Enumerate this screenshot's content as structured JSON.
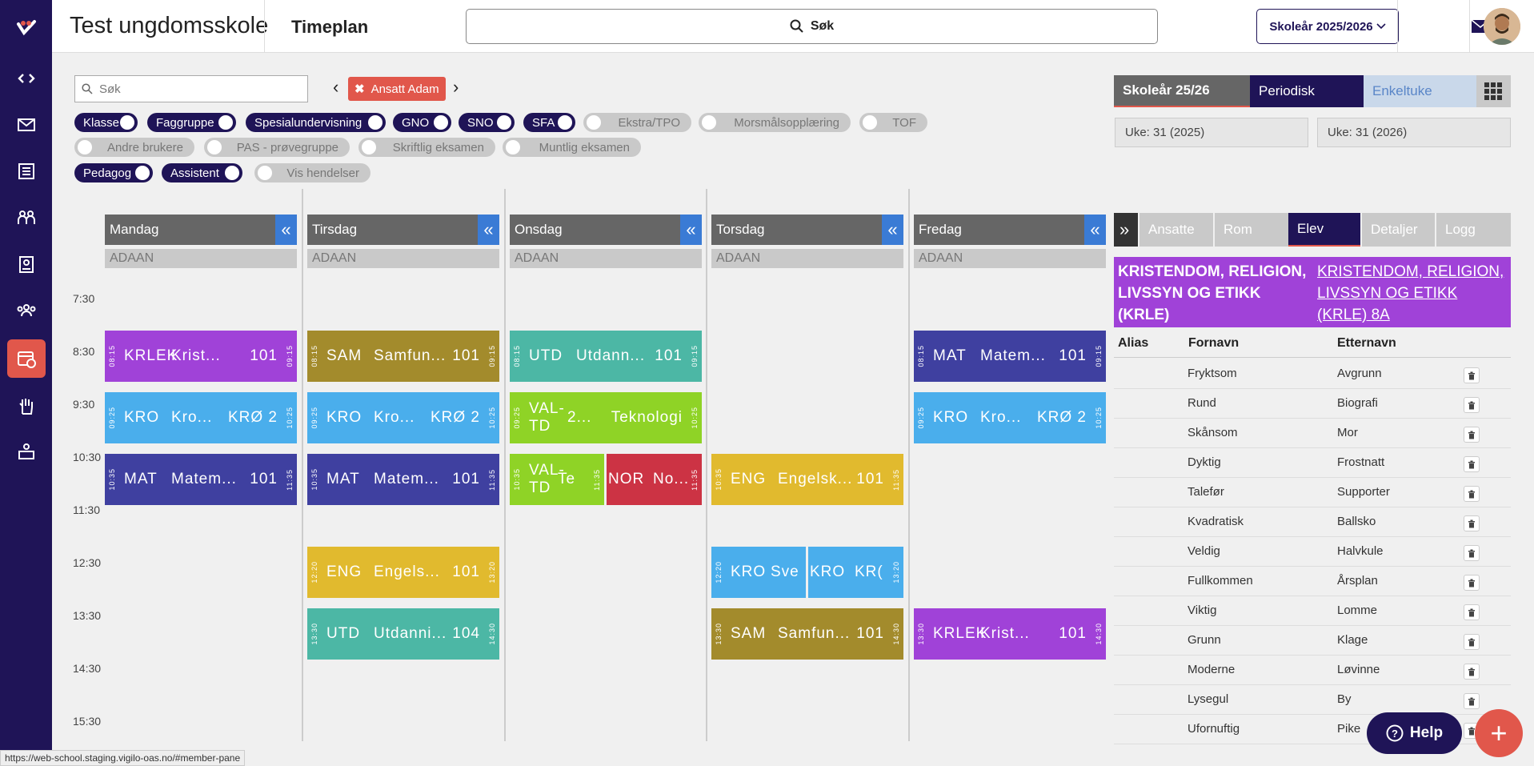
{
  "colors": {
    "brand": "#1f1457",
    "accent": "#e1574b",
    "krle": "#a042d8",
    "kro": "#4aaeec",
    "mat": "#3f40a0",
    "sam": "#a38b2c",
    "utd": "#4cb7a5",
    "val": "#8fd326",
    "eng": "#e1ba2e",
    "nor": "#cc3344"
  },
  "sidebar": {
    "icons": [
      "code-icon",
      "mail-icon",
      "newspaper-icon",
      "people-icon",
      "id-badge-icon",
      "group-icon",
      "schedule-icon",
      "hand-icon",
      "user-desk-icon"
    ],
    "active_index": 6
  },
  "header": {
    "school": "Test ungdomsskole",
    "title": "Timeplan",
    "search_label": "Søk",
    "year_select": "Skoleår 2025/2026"
  },
  "filters": {
    "search_placeholder": "Søk",
    "selected_chip": "Ansatt Adam",
    "toggles": [
      {
        "label": "Klasse",
        "on": true
      },
      {
        "label": "Faggruppe",
        "on": true
      },
      {
        "label": "Spesialundervisning",
        "on": true
      },
      {
        "label": "GNO",
        "on": true
      },
      {
        "label": "SNO",
        "on": true
      },
      {
        "label": "SFA",
        "on": true
      },
      {
        "label": "Ekstra/TPO",
        "on": false
      },
      {
        "label": "Morsmålsopplæring",
        "on": false
      },
      {
        "label": "TOF",
        "on": false
      },
      {
        "label": "Andre brukere",
        "on": false
      },
      {
        "label": "PAS - prøvegruppe",
        "on": false
      },
      {
        "label": "Skriftlig eksamen",
        "on": false
      },
      {
        "label": "Muntlig eksamen",
        "on": false
      },
      {
        "label": "Pedagog",
        "on": true
      },
      {
        "label": "Assistent",
        "on": true
      },
      {
        "label": "Vis hendelser",
        "on": false
      }
    ]
  },
  "period_tabs": [
    {
      "label": "Skoleår 25/26",
      "selected": true
    },
    {
      "label": "Periodisk",
      "selected": false
    },
    {
      "label": "Enkeltuke",
      "selected": false
    }
  ],
  "weeks": {
    "from": "Uke: 31 (2025)",
    "to": "Uke: 31 (2026)"
  },
  "days": [
    {
      "name": "Mandag",
      "res": "ADAAN"
    },
    {
      "name": "Tirsdag",
      "res": "ADAAN"
    },
    {
      "name": "Onsdag",
      "res": "ADAAN"
    },
    {
      "name": "Torsdag",
      "res": "ADAAN"
    },
    {
      "name": "Fredag",
      "res": "ADAAN"
    }
  ],
  "collapse_glyph": "«",
  "times": [
    "7:30",
    "8:30",
    "9:30",
    "10:30",
    "11:30",
    "12:30",
    "13:30",
    "14:30",
    "15:30"
  ],
  "lessons": [
    {
      "day": 0,
      "start": "08:15",
      "end": "09:15",
      "code": "KRLEK",
      "name": "Krist...",
      "room": "101",
      "color": "krle"
    },
    {
      "day": 0,
      "start": "09:25",
      "end": "10:25",
      "code": "KRO",
      "name": "Kro...",
      "room": "KRØ 2",
      "color": "kro"
    },
    {
      "day": 0,
      "start": "10:35",
      "end": "11:35",
      "code": "MAT",
      "name": "Matem...",
      "room": "101",
      "color": "mat"
    },
    {
      "day": 1,
      "start": "08:15",
      "end": "09:15",
      "code": "SAM",
      "name": "Samfun...",
      "room": "101",
      "color": "sam"
    },
    {
      "day": 1,
      "start": "09:25",
      "end": "10:25",
      "code": "KRO",
      "name": "Kro...",
      "room": "KRØ 2",
      "color": "kro"
    },
    {
      "day": 1,
      "start": "10:35",
      "end": "11:35",
      "code": "MAT",
      "name": "Matem...",
      "room": "101",
      "color": "mat"
    },
    {
      "day": 1,
      "start": "12:20",
      "end": "13:20",
      "code": "ENG",
      "name": "Engels...",
      "room": "101",
      "color": "eng"
    },
    {
      "day": 1,
      "start": "13:30",
      "end": "14:30",
      "code": "UTD",
      "name": "Utdanni...",
      "room": "104",
      "color": "utd"
    },
    {
      "day": 2,
      "start": "08:15",
      "end": "09:15",
      "code": "UTD",
      "name": "Utdann...",
      "room": "101",
      "color": "utd"
    },
    {
      "day": 2,
      "start": "09:25",
      "end": "10:25",
      "code": "VAL-TD",
      "name": "2...",
      "room": "Teknologi",
      "color": "val"
    },
    {
      "day": 2,
      "start": "10:35",
      "end": "11:35",
      "code": "VAL-TD",
      "name": "Te",
      "room": "",
      "color": "val",
      "half": "left"
    },
    {
      "day": 2,
      "start": "",
      "end": "11:35",
      "code": "NOR",
      "name": "No...",
      "room": "",
      "color": "nor",
      "half": "right"
    },
    {
      "day": 3,
      "start": "10:35",
      "end": "11:35",
      "code": "ENG",
      "name": "Engelsk...",
      "room": "101",
      "color": "eng"
    },
    {
      "day": 3,
      "start": "12:20",
      "end": "",
      "code": "KRO",
      "name": "Sve",
      "room": "",
      "color": "kro",
      "half": "left"
    },
    {
      "day": 3,
      "start": "",
      "end": "13:20",
      "code": "KRO",
      "name": "KR(",
      "room": "",
      "color": "kro",
      "half": "right"
    },
    {
      "day": 3,
      "start": "13:30",
      "end": "14:30",
      "code": "SAM",
      "name": "Samfun...",
      "room": "101",
      "color": "sam"
    },
    {
      "day": 4,
      "start": "08:15",
      "end": "09:15",
      "code": "MAT",
      "name": "Matem...",
      "room": "101",
      "color": "mat"
    },
    {
      "day": 4,
      "start": "09:25",
      "end": "10:25",
      "code": "KRO",
      "name": "Kro...",
      "room": "KRØ 2",
      "color": "kro"
    },
    {
      "day": 4,
      "start": "13:30",
      "end": "14:30",
      "code": "KRLEK",
      "name": "Krist...",
      "room": "101",
      "color": "krle"
    }
  ],
  "right_panel": {
    "expand_glyph": "»",
    "tabs": [
      {
        "label": "Ansatte",
        "selected": false
      },
      {
        "label": "Rom",
        "selected": false
      },
      {
        "label": "Elev",
        "selected": true
      },
      {
        "label": "Detaljer",
        "selected": false
      },
      {
        "label": "Logg",
        "selected": false
      }
    ],
    "subject_title": "KRISTENDOM, RELIGION, LIVSSYN OG ETIKK (KRLE)",
    "subject_link": "KRISTENDOM, RELIGION, LIVSSYN OG ETIKK (KRLE) 8A",
    "columns": {
      "alias": "Alias",
      "first": "Fornavn",
      "last": "Etternavn"
    },
    "students": [
      {
        "first": "Fryktsom",
        "last": "Avgrunn"
      },
      {
        "first": "Rund",
        "last": "Biografi"
      },
      {
        "first": "Skånsom",
        "last": "Mor"
      },
      {
        "first": "Dyktig",
        "last": "Frostnatt"
      },
      {
        "first": "Talefør",
        "last": "Supporter"
      },
      {
        "first": "Kvadratisk",
        "last": "Ballsko"
      },
      {
        "first": "Veldig",
        "last": "Halvkule"
      },
      {
        "first": "Fullkommen",
        "last": "Årsplan"
      },
      {
        "first": "Viktig",
        "last": "Lomme"
      },
      {
        "first": "Grunn",
        "last": "Klage"
      },
      {
        "first": "Moderne",
        "last": "Løvinne"
      },
      {
        "first": "Lysegul",
        "last": "By"
      },
      {
        "first": "Ufornuftig",
        "last": "Pike"
      }
    ]
  },
  "help_label": "Help",
  "fab_label": "+",
  "status_url": "https://web-school.staging.vigilo-oas.no/#member-pane"
}
